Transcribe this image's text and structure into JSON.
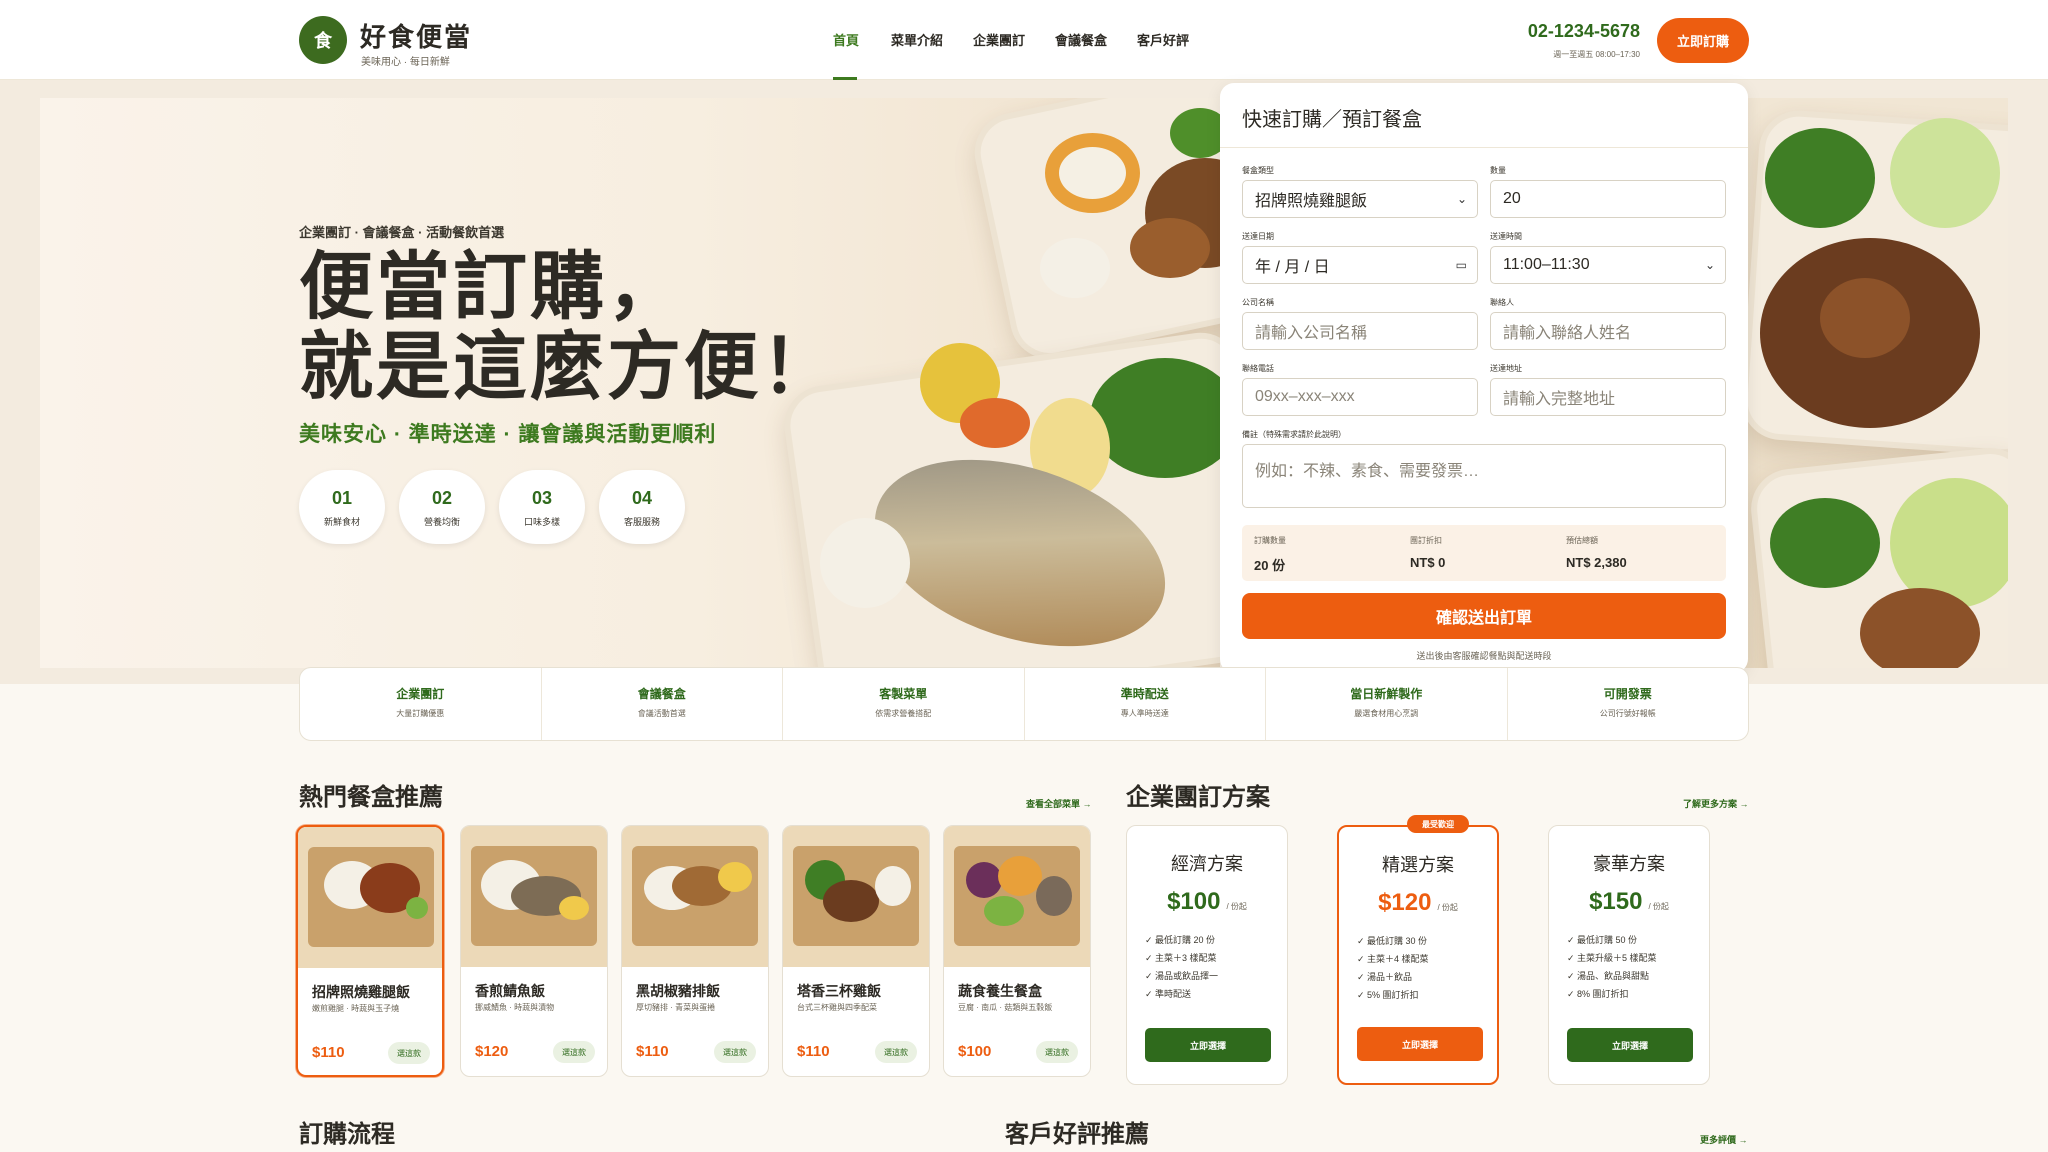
{
  "header": {
    "logo_char": "食",
    "brand": "好食便當",
    "tagline": "美味用心 · 每日新鮮",
    "nav": [
      "首頁",
      "菜單介紹",
      "企業團訂",
      "會議餐盒",
      "客戶好評"
    ],
    "phone": "02-1234-5678",
    "hours": "週一至週五 08:00–17:30",
    "order_button": "立即訂購"
  },
  "hero": {
    "tag": "企業團訂 · 會議餐盒 · 活動餐飲首選",
    "title_line1": "便當訂購，",
    "title_line2": "就是這麼方便！",
    "subtitle": "美味安心 · 準時送達 · 讓會議與活動更順利",
    "stats": [
      {
        "num": "01",
        "label": "新鮮食材"
      },
      {
        "num": "02",
        "label": "營養均衡"
      },
      {
        "num": "03",
        "label": "口味多樣"
      },
      {
        "num": "04",
        "label": "客服服務"
      }
    ]
  },
  "form": {
    "title": "快速訂購／預訂餐盒",
    "meal_type_label": "餐盒類型",
    "meal_type_value": "招牌照燒雞腿飯",
    "quantity_label": "數量",
    "quantity_value": "20",
    "date_label": "送達日期",
    "date_value": "年 / 月 / 日",
    "time_label": "送達時間",
    "time_value": "11:00–11:30",
    "company_label": "公司名稱",
    "company_placeholder": "請輸入公司名稱",
    "contact_label": "聯絡人",
    "contact_placeholder": "請輸入聯絡人姓名",
    "phone_label": "聯絡電話",
    "phone_placeholder": "09xx–xxx–xxx",
    "address_label": "送達地址",
    "address_placeholder": "請輸入完整地址",
    "note_label": "備註（特殊需求請於此說明）",
    "note_placeholder": "例如：不辣、素食、需要發票…",
    "summary": [
      {
        "label": "訂購數量",
        "value": "20 份"
      },
      {
        "label": "團訂折扣",
        "value": "NT$ 0"
      },
      {
        "label": "預估總額",
        "value": "NT$ 2,380"
      }
    ],
    "submit": "確認送出訂單",
    "note": "送出後由客服確認餐點與配送時段"
  },
  "features": [
    {
      "title": "企業團訂",
      "desc": "大量訂購優惠"
    },
    {
      "title": "會議餐盒",
      "desc": "會議活動首選"
    },
    {
      "title": "客製菜單",
      "desc": "依需求營養搭配"
    },
    {
      "title": "準時配送",
      "desc": "專人準時送達"
    },
    {
      "title": "當日新鮮製作",
      "desc": "嚴選食材用心烹調"
    },
    {
      "title": "可開發票",
      "desc": "公司行號好報帳"
    }
  ],
  "popular": {
    "title": "熱門餐盒推薦",
    "link": "查看全部菜單 →",
    "items": [
      {
        "name": "招牌照燒雞腿飯",
        "desc": "嫩煎雞腿 · 時蔬與玉子燒",
        "price": "$110",
        "pick": "選這款"
      },
      {
        "name": "香煎鯖魚飯",
        "desc": "挪威鯖魚 · 時蔬與漬物",
        "price": "$120",
        "pick": "選這款"
      },
      {
        "name": "黑胡椒豬排飯",
        "desc": "厚切豬排 · 青菜與蛋捲",
        "price": "$110",
        "pick": "選這款"
      },
      {
        "name": "塔香三杯雞飯",
        "desc": "台式三杯雞與四季配菜",
        "price": "$110",
        "pick": "選這款"
      },
      {
        "name": "蔬食養生餐盒",
        "desc": "豆腐 · 南瓜 · 菇類與五穀飯",
        "price": "$100",
        "pick": "選這款"
      }
    ]
  },
  "plans": {
    "title": "企業團訂方案",
    "link": "了解更多方案 →",
    "badge": "最受歡迎",
    "unit": "/ 份起",
    "items": [
      {
        "name": "經濟方案",
        "price": "$100",
        "features": [
          "✓ 最低訂購 20 份",
          "✓ 主菜＋3 樣配菜",
          "✓ 湯品或飲品擇一",
          "✓ 準時配送"
        ],
        "button": "立即選擇"
      },
      {
        "name": "精選方案",
        "price": "$120",
        "features": [
          "✓ 最低訂購 30 份",
          "✓ 主菜＋4 樣配菜",
          "✓ 湯品＋飲品",
          "✓ 5% 團訂折扣"
        ],
        "button": "立即選擇"
      },
      {
        "name": "豪華方案",
        "price": "$150",
        "features": [
          "✓ 最低訂購 50 份",
          "✓ 主菜升級＋5 樣配菜",
          "✓ 湯品、飲品與甜點",
          "✓ 8% 團訂折扣"
        ],
        "button": "立即選擇"
      }
    ]
  },
  "process": {
    "title": "訂購流程"
  },
  "reviews": {
    "title": "客戶好評推薦",
    "link": "更多評價 →"
  }
}
